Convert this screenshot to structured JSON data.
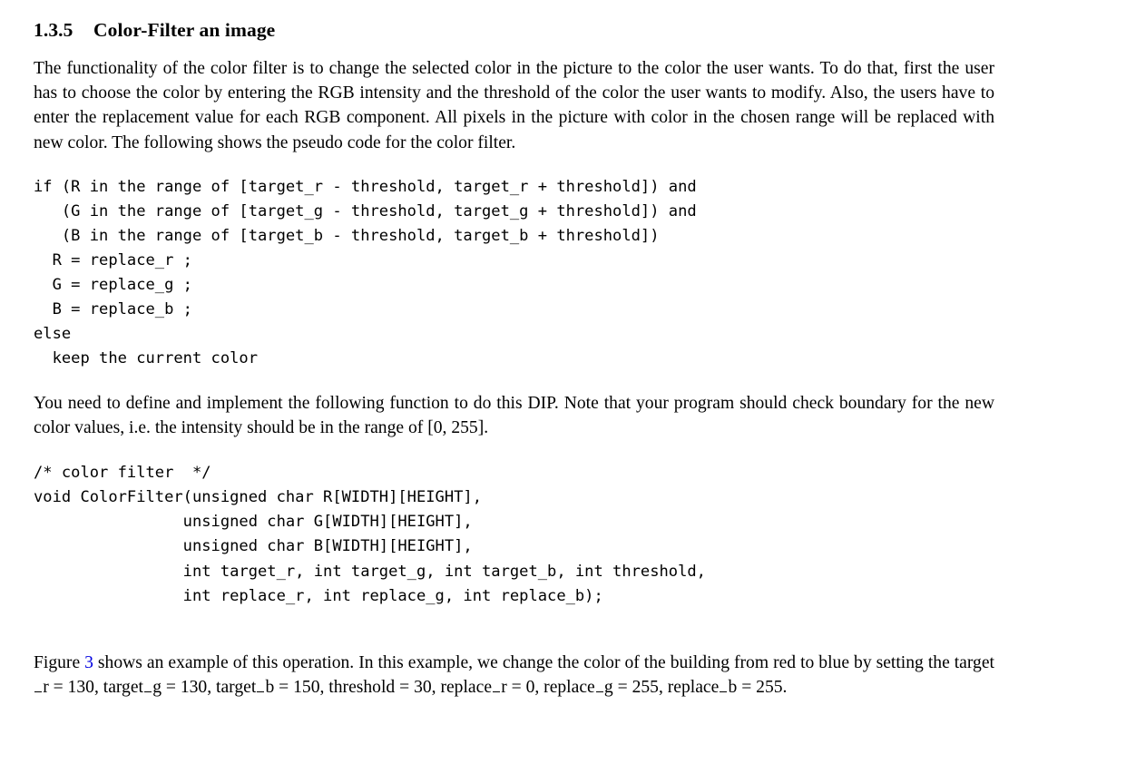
{
  "document": {
    "heading": {
      "number": "1.3.5",
      "title": "Color-Filter an image"
    },
    "paragraph_1": "The functionality of the color filter is to change the selected color in the picture to the color the user wants. To do that, first the user has to choose the color by entering the RGB intensity and the threshold of the color the user wants to modify. Also, the users have to enter the replacement value for each RGB component. All pixels in the picture with color in the chosen range will be replaced with new color. The following shows the pseudo code for the color filter.",
    "pseudocode": "if (R in the range of [target_r - threshold, target_r + threshold]) and\n   (G in the range of [target_g - threshold, target_g + threshold]) and\n   (B in the range of [target_b - threshold, target_b + threshold])\n  R = replace_r ;\n  G = replace_g ;\n  B = replace_b ;\nelse\n  keep the current color",
    "paragraph_2": "You need to define and implement the following function to do this DIP. Note that your program should check boundary for the new color values, i.e. the intensity should be in the range of [0, 255].",
    "function_signature": "/* color filter  */\nvoid ColorFilter(unsigned char R[WIDTH][HEIGHT],\n                unsigned char G[WIDTH][HEIGHT],\n                unsigned char B[WIDTH][HEIGHT],\n                int target_r, int target_g, int target_b, int threshold,\n                int replace_r, int replace_g, int replace_b);",
    "paragraph_3": {
      "part_1": "Figure ",
      "figure_ref": "3",
      "part_2": " shows an example of this operation. In this example, we change the color of the building from red to blue by setting the target",
      "var_r_suffix": "r = 130, target",
      "var_g_suffix": "g = 130, target",
      "var_b_suffix": "b = 150, threshold = 30, replace",
      "rep_r_suffix": "r = 0, replace",
      "rep_g_suffix": "g = 255, replace",
      "rep_b_suffix": "b = 255."
    },
    "values": {
      "target_r": 130,
      "target_g": 130,
      "target_b": 150,
      "threshold": 30,
      "replace_r": 0,
      "replace_g": 255,
      "replace_b": 255,
      "intensity_range": "[0, 255]",
      "figure_number": 3
    },
    "colors": {
      "text": "#000000",
      "link": "#0000e0",
      "background": "#ffffff"
    }
  }
}
